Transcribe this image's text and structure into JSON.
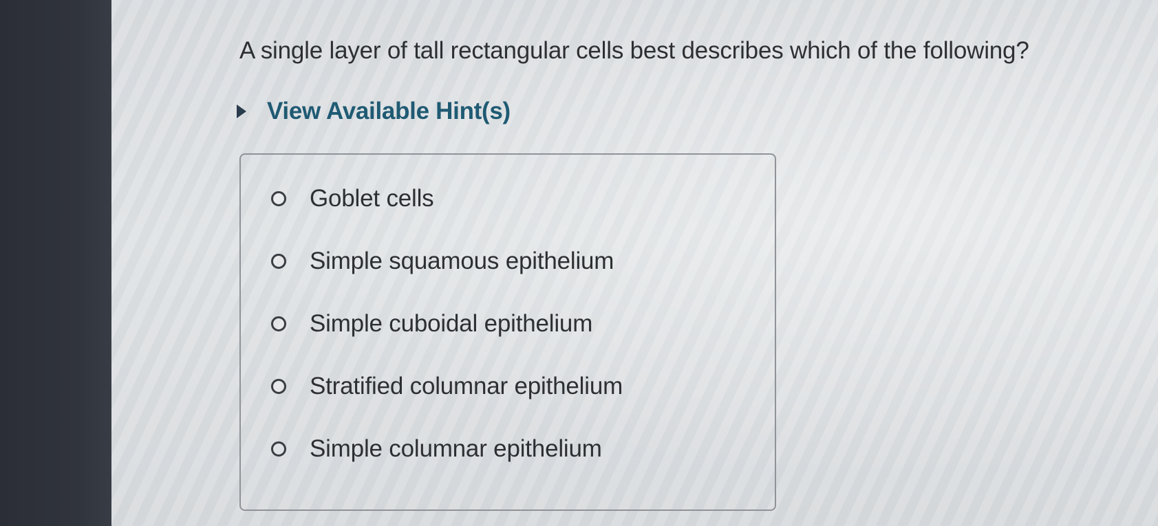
{
  "question": {
    "text": "A single layer of tall rectangular cells best describes which of the following?"
  },
  "hints": {
    "toggle_label": "View Available Hint(s)"
  },
  "answers": {
    "options": [
      {
        "label": "Goblet cells",
        "selected": false
      },
      {
        "label": "Simple squamous epithelium",
        "selected": false
      },
      {
        "label": "Simple cuboidal epithelium",
        "selected": false
      },
      {
        "label": "Stratified columnar epithelium",
        "selected": false
      },
      {
        "label": "Simple columnar epithelium",
        "selected": false
      }
    ]
  },
  "colors": {
    "hint_link": "#1f5a73",
    "text": "#2d2f33",
    "border": "#8f9398"
  },
  "icons": {
    "hint_toggle": "caret-right-icon",
    "option": "radio-unchecked-icon"
  }
}
